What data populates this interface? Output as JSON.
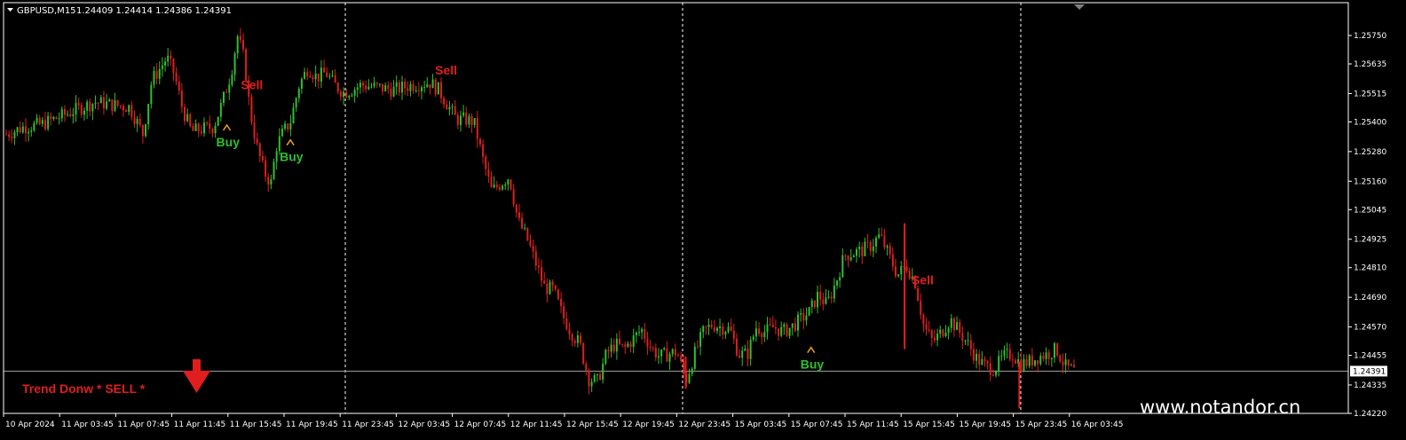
{
  "header": {
    "symbol": "GBPUSD,M15",
    "ohlc": "1.24409 1.24414 1.24386 1.24391"
  },
  "watermark": "www.notandor.cn",
  "trend": {
    "label": "Trend Donw * SELL *",
    "arrow_icon": "down-arrow-icon",
    "color": "#e01e1e"
  },
  "colors": {
    "background": "#000000",
    "bull": "#2fbf2f",
    "bear": "#e01e1e",
    "grid": "#ffffff",
    "price_label_bg": "#ffffff",
    "signal_marker": "#e8a317"
  },
  "chart_data": {
    "type": "candlestick",
    "timeframe": "M15",
    "current_price": 1.24391,
    "ylim": [
      1.2422,
      1.2581
    ],
    "y_ticks": [
      1.2575,
      1.25635,
      1.25515,
      1.254,
      1.2528,
      1.2516,
      1.25045,
      1.24925,
      1.2481,
      1.2469,
      1.2457,
      1.24455,
      1.24335,
      1.2422
    ],
    "x_ticks": [
      "10 Apr 2024",
      "11 Apr 03:45",
      "11 Apr 07:45",
      "11 Apr 11:45",
      "11 Apr 15:45",
      "11 Apr 19:45",
      "11 Apr 23:45",
      "12 Apr 03:45",
      "12 Apr 07:45",
      "12 Apr 11:45",
      "12 Apr 15:45",
      "12 Apr 19:45",
      "12 Apr 23:45",
      "15 Apr 03:45",
      "15 Apr 07:45",
      "15 Apr 11:45",
      "15 Apr 15:45",
      "15 Apr 19:45",
      "15 Apr 23:45",
      "16 Apr 03:45"
    ],
    "bar_count": 384,
    "session_dividers": [
      "11 Apr 23:45",
      "12 Apr 23:45",
      "15 Apr 23:45"
    ],
    "close_path": [
      [
        0,
        1.2535
      ],
      [
        20,
        1.2538
      ],
      [
        40,
        1.2539
      ],
      [
        60,
        1.2542
      ],
      [
        80,
        1.2545
      ],
      [
        100,
        1.2548
      ],
      [
        120,
        1.2547
      ],
      [
        140,
        1.2546
      ],
      [
        155,
        1.2535
      ],
      [
        165,
        1.2557
      ],
      [
        175,
        1.2562
      ],
      [
        182,
        1.2566
      ],
      [
        190,
        1.256
      ],
      [
        200,
        1.2545
      ],
      [
        210,
        1.2536
      ],
      [
        220,
        1.2537
      ],
      [
        235,
        1.2538
      ],
      [
        245,
        1.2548
      ],
      [
        255,
        1.256
      ],
      [
        262,
        1.2575
      ],
      [
        270,
        1.2565
      ],
      [
        276,
        1.2545
      ],
      [
        284,
        1.253
      ],
      [
        292,
        1.252
      ],
      [
        300,
        1.2515
      ],
      [
        306,
        1.253
      ],
      [
        314,
        1.2536
      ],
      [
        322,
        1.254
      ],
      [
        332,
        1.2555
      ],
      [
        342,
        1.2562
      ],
      [
        352,
        1.2558
      ],
      [
        362,
        1.256
      ],
      [
        372,
        1.2555
      ],
      [
        382,
        1.2552
      ],
      [
        392,
        1.2553
      ],
      [
        402,
        1.2555
      ],
      [
        420,
        1.2554
      ],
      [
        440,
        1.2553
      ],
      [
        460,
        1.2555
      ],
      [
        480,
        1.2556
      ],
      [
        490,
        1.2553
      ],
      [
        500,
        1.2547
      ],
      [
        510,
        1.2541
      ],
      [
        520,
        1.2541
      ],
      [
        530,
        1.254
      ],
      [
        540,
        1.2525
      ],
      [
        550,
        1.2512
      ],
      [
        560,
        1.2515
      ],
      [
        570,
        1.2518
      ],
      [
        580,
        1.25
      ],
      [
        590,
        1.2493
      ],
      [
        600,
        1.2483
      ],
      [
        610,
        1.2473
      ],
      [
        620,
        1.2472
      ],
      [
        630,
        1.2462
      ],
      [
        640,
        1.2455
      ],
      [
        650,
        1.245
      ],
      [
        660,
        1.2436
      ],
      [
        670,
        1.2435
      ],
      [
        680,
        1.2446
      ],
      [
        690,
        1.245
      ],
      [
        700,
        1.2448
      ],
      [
        710,
        1.2452
      ],
      [
        720,
        1.2456
      ],
      [
        730,
        1.2449
      ],
      [
        740,
        1.2445
      ],
      [
        750,
        1.2446
      ],
      [
        760,
        1.2447
      ],
      [
        770,
        1.2435
      ],
      [
        780,
        1.2446
      ],
      [
        790,
        1.2455
      ],
      [
        800,
        1.2458
      ],
      [
        810,
        1.2457
      ],
      [
        820,
        1.2456
      ],
      [
        830,
        1.2446
      ],
      [
        840,
        1.2446
      ],
      [
        850,
        1.2457
      ],
      [
        860,
        1.2455
      ],
      [
        870,
        1.2457
      ],
      [
        880,
        1.2455
      ],
      [
        890,
        1.2457
      ],
      [
        900,
        1.246
      ],
      [
        910,
        1.2463
      ],
      [
        920,
        1.247
      ],
      [
        930,
        1.2466
      ],
      [
        940,
        1.2475
      ],
      [
        950,
        1.2486
      ],
      [
        960,
        1.2487
      ],
      [
        970,
        1.2488
      ],
      [
        980,
        1.249
      ],
      [
        990,
        1.2494
      ],
      [
        1000,
        1.2486
      ],
      [
        1010,
        1.2478
      ],
      [
        1020,
        1.2482
      ],
      [
        1030,
        1.2475
      ],
      [
        1040,
        1.2457
      ],
      [
        1050,
        1.2451
      ],
      [
        1060,
        1.2455
      ],
      [
        1070,
        1.246
      ],
      [
        1080,
        1.2455
      ],
      [
        1090,
        1.245
      ],
      [
        1100,
        1.2444
      ],
      [
        1110,
        1.2441
      ],
      [
        1120,
        1.244
      ],
      [
        1130,
        1.2445
      ],
      [
        1140,
        1.2446
      ],
      [
        1150,
        1.2442
      ],
      [
        1160,
        1.2443
      ],
      [
        1170,
        1.2445
      ],
      [
        1180,
        1.2446
      ],
      [
        1190,
        1.2448
      ],
      [
        1200,
        1.2441
      ],
      [
        1210,
        1.24391
      ]
    ],
    "wick_spikes": [
      {
        "index": 1018,
        "high": 1.2499,
        "low": 1.2451
      },
      {
        "index": 1018,
        "high": 1.2496,
        "low": 1.2448
      },
      {
        "index": 1148,
        "high": 1.2443,
        "low": 1.2424
      },
      {
        "index": 770,
        "high": 1.2445,
        "low": 1.2432
      }
    ],
    "signals": [
      {
        "type": "buy",
        "label": "Buy",
        "index": 250,
        "price": 1.2538
      },
      {
        "type": "sell",
        "label": "Sell",
        "index": 272,
        "price": 1.2555
      },
      {
        "type": "buy",
        "label": "Buy",
        "index": 322,
        "price": 1.2532
      },
      {
        "type": "sell",
        "label": "Sell",
        "index": 492,
        "price": 1.2561
      },
      {
        "type": "buy",
        "label": "Buy",
        "index": 912,
        "price": 1.2448
      },
      {
        "type": "sell",
        "label": "Sell",
        "index": 1032,
        "price": 1.2476
      }
    ]
  }
}
